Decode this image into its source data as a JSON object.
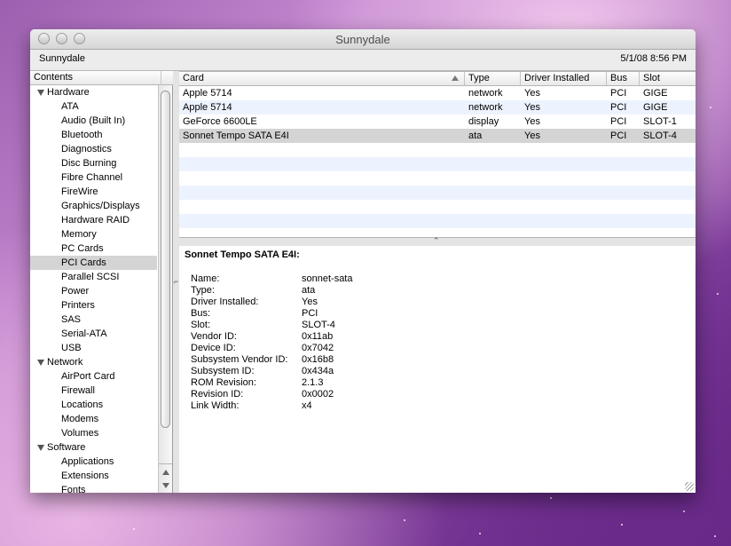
{
  "window": {
    "title": "Sunnydale",
    "toolbar_left": "Sunnydale",
    "toolbar_right": "5/1/08 8:56 PM"
  },
  "sidebar": {
    "header": "Contents",
    "items": [
      {
        "label": "Hardware",
        "type": "category"
      },
      {
        "label": "ATA",
        "type": "item"
      },
      {
        "label": "Audio (Built In)",
        "type": "item"
      },
      {
        "label": "Bluetooth",
        "type": "item"
      },
      {
        "label": "Diagnostics",
        "type": "item"
      },
      {
        "label": "Disc Burning",
        "type": "item"
      },
      {
        "label": "Fibre Channel",
        "type": "item"
      },
      {
        "label": "FireWire",
        "type": "item"
      },
      {
        "label": "Graphics/Displays",
        "type": "item"
      },
      {
        "label": "Hardware RAID",
        "type": "item"
      },
      {
        "label": "Memory",
        "type": "item"
      },
      {
        "label": "PC Cards",
        "type": "item"
      },
      {
        "label": "PCI Cards",
        "type": "item",
        "selected": true
      },
      {
        "label": "Parallel SCSI",
        "type": "item"
      },
      {
        "label": "Power",
        "type": "item"
      },
      {
        "label": "Printers",
        "type": "item"
      },
      {
        "label": "SAS",
        "type": "item"
      },
      {
        "label": "Serial-ATA",
        "type": "item"
      },
      {
        "label": "USB",
        "type": "item"
      },
      {
        "label": "Network",
        "type": "category"
      },
      {
        "label": "AirPort Card",
        "type": "item"
      },
      {
        "label": "Firewall",
        "type": "item"
      },
      {
        "label": "Locations",
        "type": "item"
      },
      {
        "label": "Modems",
        "type": "item"
      },
      {
        "label": "Volumes",
        "type": "item"
      },
      {
        "label": "Software",
        "type": "category"
      },
      {
        "label": "Applications",
        "type": "item"
      },
      {
        "label": "Extensions",
        "type": "item"
      },
      {
        "label": "Fonts",
        "type": "item"
      }
    ]
  },
  "table": {
    "columns": [
      "Card",
      "Type",
      "Driver Installed",
      "Bus",
      "Slot"
    ],
    "rows": [
      [
        "Apple 5714",
        "network",
        "Yes",
        "PCI",
        "GIGE"
      ],
      [
        "Apple 5714",
        "network",
        "Yes",
        "PCI",
        "GIGE"
      ],
      [
        "GeForce 6600LE",
        "display",
        "Yes",
        "PCI",
        "SLOT-1"
      ],
      [
        "Sonnet Tempo SATA E4I",
        "ata",
        "Yes",
        "PCI",
        "SLOT-4"
      ]
    ],
    "selected_row": 3
  },
  "detail": {
    "title": "Sonnet Tempo SATA E4I:",
    "properties": [
      [
        "Name:",
        "sonnet-sata"
      ],
      [
        "Type:",
        "ata"
      ],
      [
        "Driver Installed:",
        "Yes"
      ],
      [
        "Bus:",
        "PCI"
      ],
      [
        "Slot:",
        "SLOT-4"
      ],
      [
        "Vendor ID:",
        "0x11ab"
      ],
      [
        "Device ID:",
        "0x7042"
      ],
      [
        "Subsystem Vendor ID:",
        "0x16b8"
      ],
      [
        "Subsystem ID:",
        "0x434a"
      ],
      [
        "ROM Revision:",
        "2.1.3"
      ],
      [
        "Revision ID:",
        "0x0002"
      ],
      [
        "Link Width:",
        "x4"
      ]
    ]
  },
  "colors": {
    "alt_row": "#edf3fe",
    "selection": "#d4d4d4"
  }
}
